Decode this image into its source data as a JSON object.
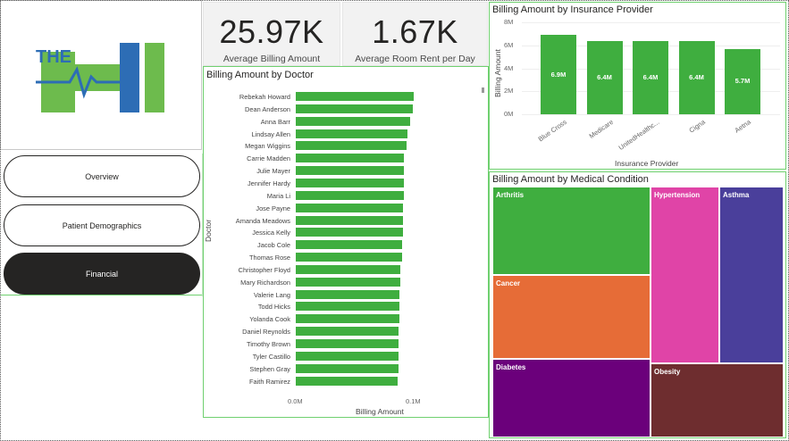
{
  "kpis": {
    "billing": {
      "value": "25.97K",
      "label": "Average Billing Amount"
    },
    "room": {
      "value": "1.67K",
      "label": "Average Room Rent per Day"
    }
  },
  "logo": {
    "text": "THE"
  },
  "nav": {
    "overview": "Overview",
    "demographics": "Patient Demographics",
    "financial": "Financial"
  },
  "doctor_chart": {
    "title": "Billing Amount by Doctor",
    "ylabel": "Doctor",
    "xlabel": "Billing Amount",
    "ticks": [
      "0.0M",
      "0.1M"
    ]
  },
  "insurance_chart": {
    "title": "Billing Amount by Insurance Provider",
    "ylabel": "Billing Amount",
    "xlabel": "Insurance Provider",
    "yticks": [
      "8M",
      "6M",
      "4M",
      "2M",
      "0M"
    ]
  },
  "treemap": {
    "title": "Billing Amount by Medical Condition"
  },
  "chart_data": [
    {
      "type": "bar",
      "orientation": "horizontal",
      "title": "Billing Amount by Doctor",
      "xlabel": "Billing Amount",
      "ylabel": "Doctor",
      "xlim": [
        0,
        0.1
      ],
      "categories": [
        "Rebekah Howard",
        "Dean Anderson",
        "Anna Barr",
        "Lindsay Allen",
        "Megan Wiggins",
        "Carrie Madden",
        "Julie Mayer",
        "Jennifer Hardy",
        "Maria Li",
        "Jose Payne",
        "Amanda Meadows",
        "Jessica Kelly",
        "Jacob Cole",
        "Thomas Rose",
        "Christopher Floyd",
        "Mary Richardson",
        "Valerie Lang",
        "Todd Hicks",
        "Yolanda Cook",
        "Daniel Reynolds",
        "Timothy Brown",
        "Tyler Castillo",
        "Stephen Gray",
        "Faith Ramirez"
      ],
      "values": [
        0.1,
        0.099,
        0.097,
        0.095,
        0.094,
        0.092,
        0.092,
        0.092,
        0.092,
        0.091,
        0.091,
        0.091,
        0.09,
        0.09,
        0.089,
        0.089,
        0.088,
        0.088,
        0.088,
        0.087,
        0.087,
        0.087,
        0.087,
        0.086
      ],
      "units": "M"
    },
    {
      "type": "bar",
      "title": "Billing Amount by Insurance Provider",
      "xlabel": "Insurance Provider",
      "ylabel": "Billing Amount",
      "ylim": [
        0,
        8
      ],
      "categories": [
        "Blue Cross",
        "Medicare",
        "UnitedHealthc...",
        "Cigna",
        "Aetna"
      ],
      "values": [
        6.9,
        6.4,
        6.4,
        6.4,
        5.7
      ],
      "labels": [
        "6.9M",
        "6.4M",
        "6.4M",
        "6.4M",
        "5.7M"
      ],
      "units": "M"
    },
    {
      "type": "treemap",
      "title": "Billing Amount by Medical Condition",
      "categories": [
        "Arthritis",
        "Cancer",
        "Diabetes",
        "Hypertension",
        "Asthma",
        "Obesity"
      ],
      "colors": [
        "#3fae3f",
        "#e66c37",
        "#6b007b",
        "#e044a7",
        "#4a3f9b",
        "#6e2d2f"
      ]
    }
  ]
}
